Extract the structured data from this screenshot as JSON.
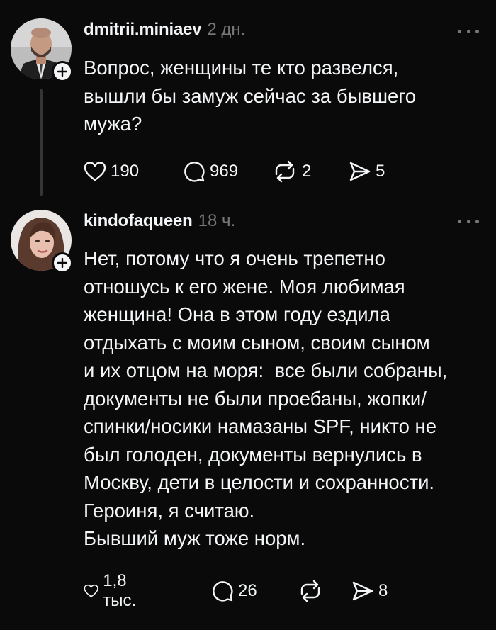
{
  "posts": [
    {
      "username": "dmitrii.miniaev",
      "time": "2 дн.",
      "text": "Вопрос, женщины те кто развелся,\nвышли бы замуж сейчас за бывшего\nмужа?",
      "likes": "190",
      "replies": "969",
      "reposts": "2",
      "shares": "5"
    },
    {
      "username": "kindofaqueen",
      "time": "18 ч.",
      "text": "Нет, потому что я очень трепетно\nотношусь к его жене. Моя любимая\nженщина! Она в этом году ездила\nотдыхать с моим сыном, своим сыном\nи их отцом на моря:  все были собраны,\nдокументы не были проебаны, жопки/\nспинки/носики намазаны SPF, никто не\nбыл голоден, документы вернулись в\nМоскву, дети в целости и сохранности.\nГероиня, я считаю.\nБывший муж тоже норм.",
      "likes": "1,8 тыс.",
      "replies": "26",
      "reposts": "",
      "shares": "8"
    }
  ],
  "icons": {
    "more": "more-dots-icon",
    "like": "heart-icon",
    "reply": "comment-icon",
    "repost": "repost-icon",
    "share": "send-icon",
    "follow": "plus-icon"
  },
  "colors": {
    "background": "#0a0a0a",
    "text": "#f3f5f7",
    "muted": "#777777",
    "thread_line": "#333638"
  }
}
